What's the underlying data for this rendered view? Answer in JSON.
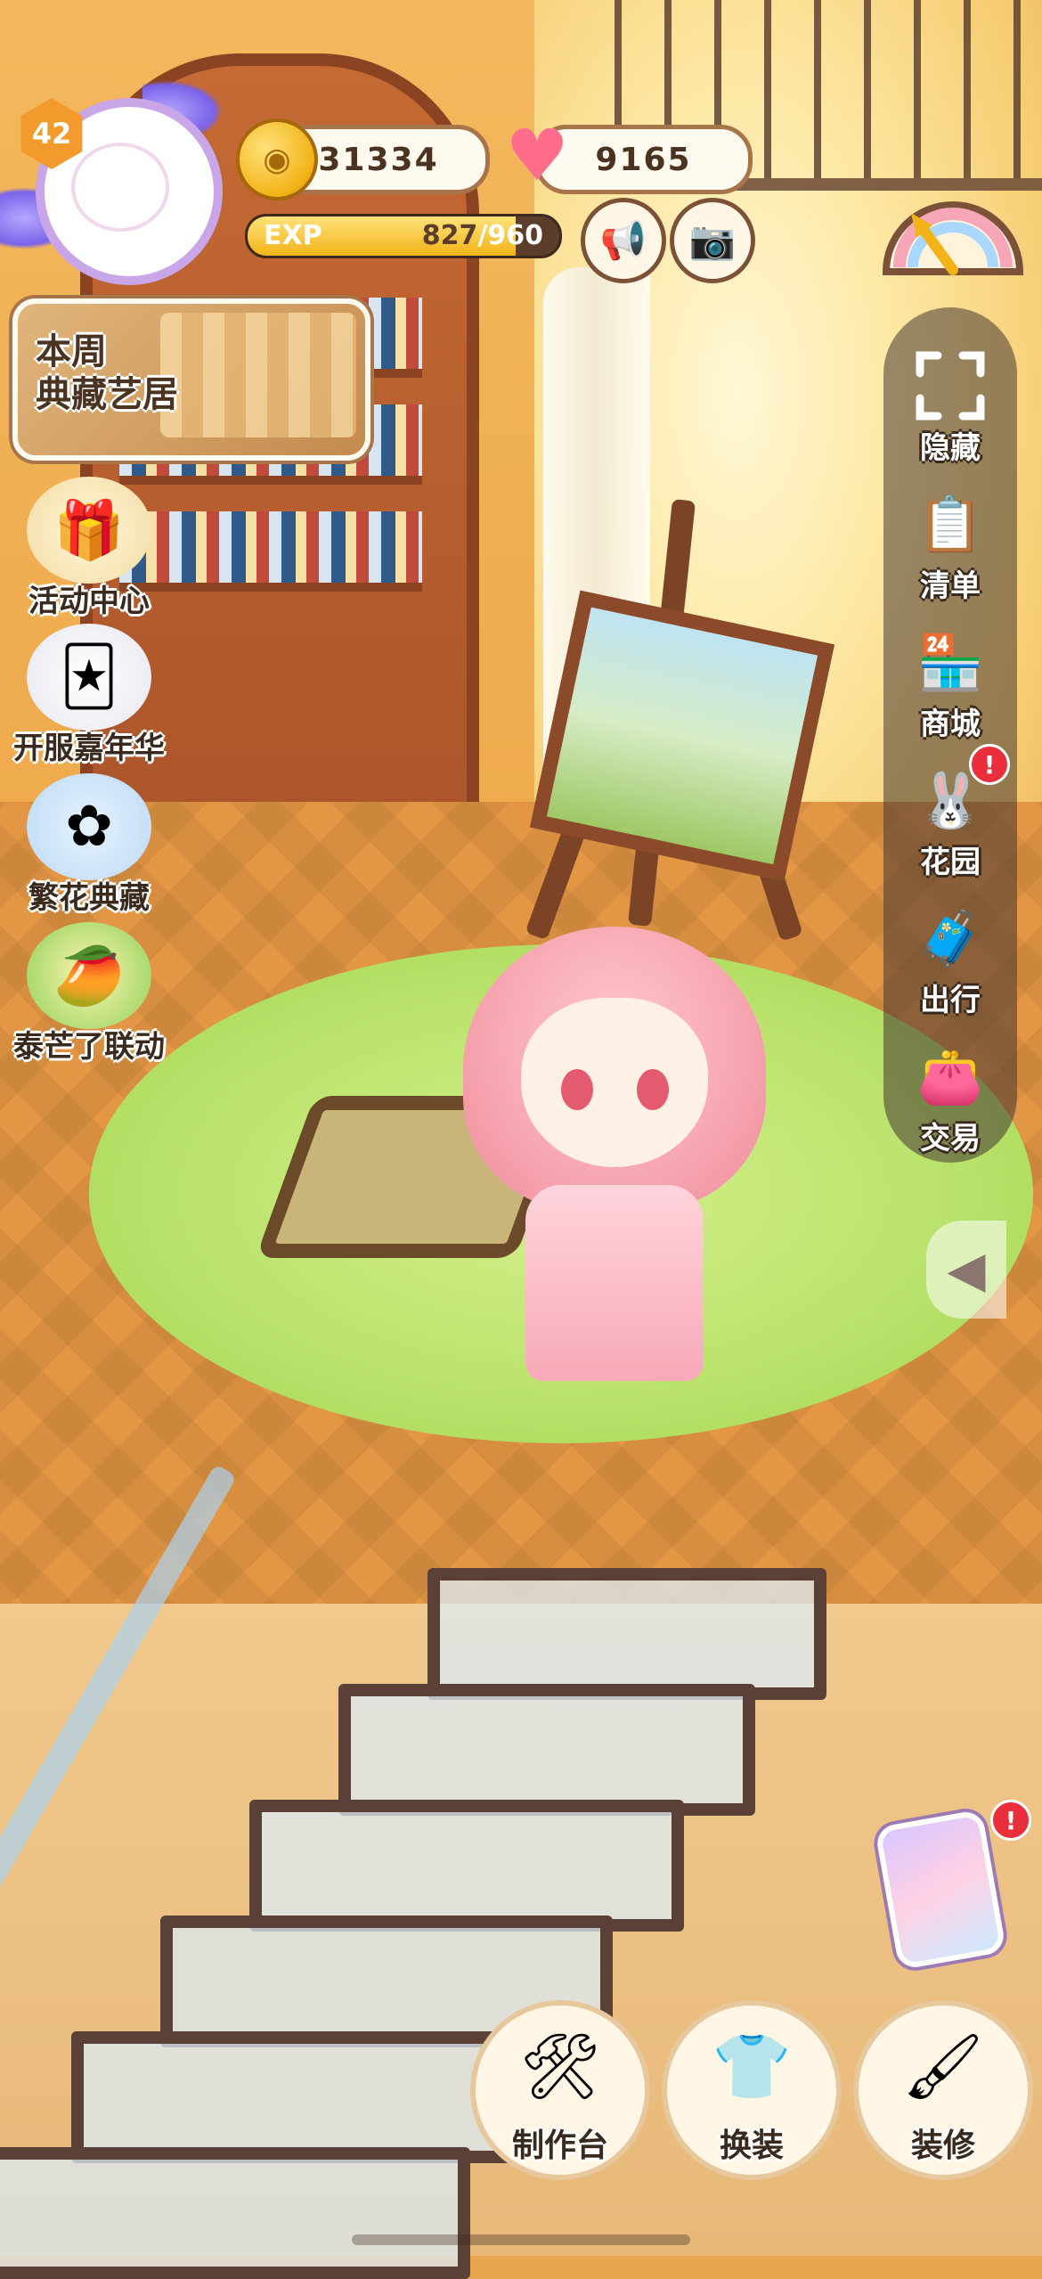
{
  "player": {
    "level": "42",
    "coins": "31334",
    "hearts": "9165",
    "exp_label": "EXP",
    "exp_current": "827",
    "exp_max": "/960",
    "exp_fraction": 0.861
  },
  "weekly_banner": {
    "line1": "本周",
    "line2": "典藏艺居"
  },
  "left_menu": [
    {
      "label": "活动中心",
      "icon": "gift-box-icon"
    },
    {
      "label": "开服嘉年华",
      "icon": "jester-icon"
    },
    {
      "label": "繁花典藏",
      "icon": "blue-flowers-icon"
    },
    {
      "label": "泰芒了联动",
      "icon": "mango-mascot-icon"
    }
  ],
  "right_menu": [
    {
      "label": "隐藏",
      "icon": "frame-corners-icon"
    },
    {
      "label": "清单",
      "icon": "checklist-icon"
    },
    {
      "label": "商城",
      "icon": "shop-icon"
    },
    {
      "label": "花园",
      "icon": "garden-icon",
      "badge": "!"
    },
    {
      "label": "出行",
      "icon": "suitcase-icon"
    },
    {
      "label": "交易",
      "icon": "wallet-icon"
    }
  ],
  "phone": {
    "badge": "!"
  },
  "bottom_bar": [
    {
      "label": "制作台",
      "icon": "workbench-icon"
    },
    {
      "label": "换装",
      "icon": "outfit-icon"
    },
    {
      "label": "装修",
      "icon": "paint-roller-icon"
    }
  ],
  "colors": {
    "accent_brown": "#7b5238",
    "badge_red": "#ea2e3c",
    "exp_gold": "#f2b318",
    "level_orange": "#f39a2c"
  }
}
